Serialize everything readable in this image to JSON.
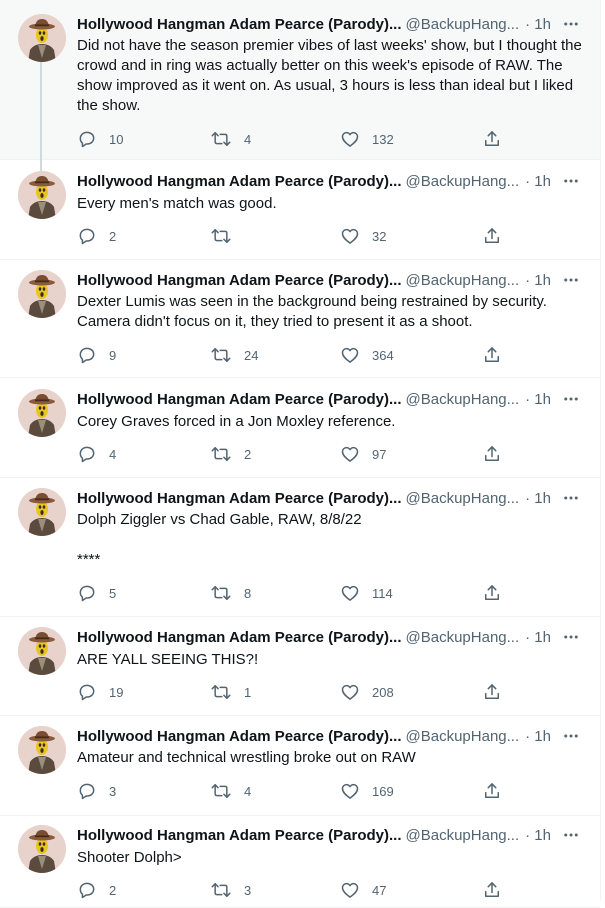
{
  "colors": {
    "text": "#0f1419",
    "secondary": "#536471",
    "border": "#eff3f4",
    "highlight_bg": "#f7f9f9",
    "thread_line": "#cfd9de"
  },
  "icons": {
    "reply": "reply-icon",
    "retweet": "retweet-icon",
    "like": "like-icon",
    "share": "share-icon",
    "more": "more-icon"
  },
  "tweets": [
    {
      "name": "Hollywood Hangman Adam Pearce (Parody)...",
      "handle": "@BackupHang...",
      "time": "· 1h",
      "text": "Did not have the season premier vibes of last weeks' show, but I thought the crowd and in ring was actually better on this week's episode of RAW. The show improved as it went on. As usual, 3 hours is less than ideal but I liked the show.",
      "replies": "10",
      "retweets": "4",
      "likes": "132"
    },
    {
      "name": "Hollywood Hangman Adam Pearce (Parody)...",
      "handle": "@BackupHang...",
      "time": "· 1h",
      "text": "Every men's match was good.",
      "replies": "2",
      "retweets": "",
      "likes": "32"
    },
    {
      "name": "Hollywood Hangman Adam Pearce (Parody)...",
      "handle": "@BackupHang...",
      "time": "· 1h",
      "text": "Dexter Lumis was seen in the background being restrained by security. Camera didn't focus on it, they tried to present it as a shoot.",
      "replies": "9",
      "retweets": "24",
      "likes": "364"
    },
    {
      "name": "Hollywood Hangman Adam Pearce (Parody)...",
      "handle": "@BackupHang...",
      "time": "· 1h",
      "text": "Corey Graves forced in a Jon Moxley reference.",
      "replies": "4",
      "retweets": "2",
      "likes": "97"
    },
    {
      "name": "Hollywood Hangman Adam Pearce (Parody)...",
      "handle": "@BackupHang...",
      "time": "· 1h",
      "text": "Dolph Ziggler vs Chad Gable, RAW, 8/8/22\n\n****",
      "replies": "5",
      "retweets": "8",
      "likes": "114"
    },
    {
      "name": "Hollywood Hangman Adam Pearce (Parody)...",
      "handle": "@BackupHang...",
      "time": "· 1h",
      "text": "ARE YALL SEEING THIS?!",
      "replies": "19",
      "retweets": "1",
      "likes": "208"
    },
    {
      "name": "Hollywood Hangman Adam Pearce (Parody)...",
      "handle": "@BackupHang...",
      "time": "· 1h",
      "text": "Amateur and technical wrestling broke out on RAW",
      "replies": "3",
      "retweets": "4",
      "likes": "169"
    },
    {
      "name": "Hollywood Hangman Adam Pearce (Parody)...",
      "handle": "@BackupHang...",
      "time": "· 1h",
      "text": "Shooter Dolph>",
      "replies": "2",
      "retweets": "3",
      "likes": "47"
    }
  ]
}
